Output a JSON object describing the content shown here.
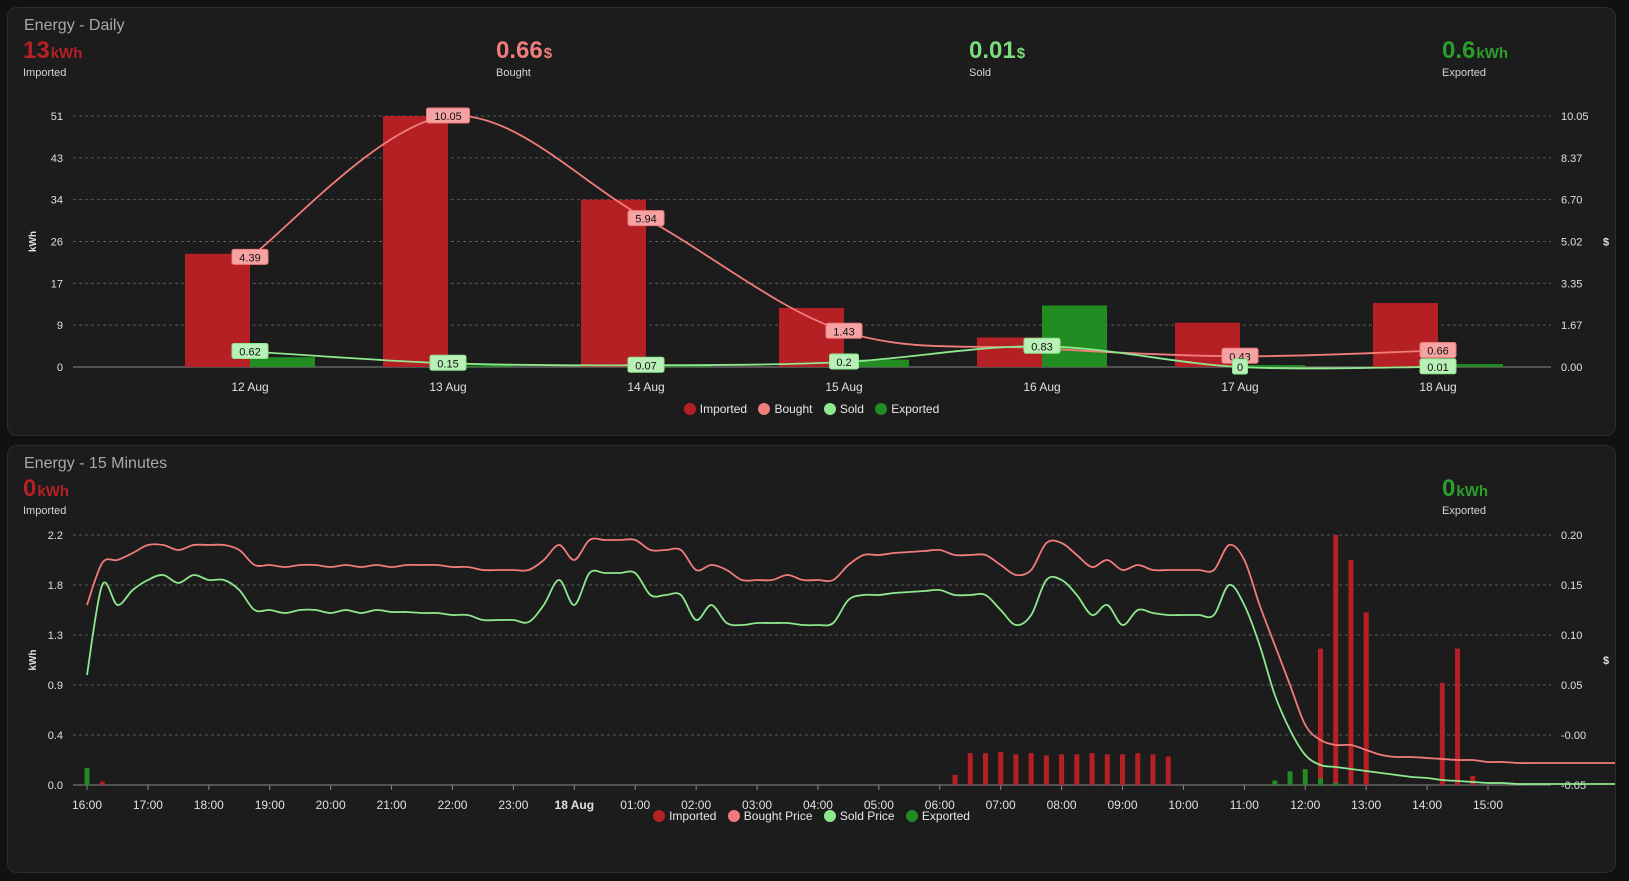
{
  "colors": {
    "imported": "#b52025",
    "bought": "#f07c7c",
    "sold": "#8ee88e",
    "exported": "#228b22",
    "sold_stat": "#7bdc7b",
    "exported_stat": "#2aa02a"
  },
  "daily": {
    "title": "Energy - Daily",
    "stats": [
      {
        "value": "13",
        "unit": "kWh",
        "label": "Imported"
      },
      {
        "value": "0.66",
        "unit": "$",
        "label": "Bought"
      },
      {
        "value": "0.01",
        "unit": "$",
        "label": "Sold"
      },
      {
        "value": "0.6",
        "unit": "kWh",
        "label": "Exported"
      }
    ],
    "legend": [
      "Imported",
      "Bought",
      "Sold",
      "Exported"
    ]
  },
  "quarter": {
    "title": "Energy - 15 Minutes",
    "stats": [
      {
        "value": "0",
        "unit": "kWh",
        "label": "Imported"
      },
      {
        "value": "0",
        "unit": "kWh",
        "label": "Exported"
      }
    ],
    "legend": [
      "Imported",
      "Bought Price",
      "Sold Price",
      "Exported"
    ]
  },
  "chart_data": [
    {
      "type": "bar",
      "title": "Energy - Daily",
      "categories": [
        "12 Aug",
        "13 Aug",
        "14 Aug",
        "15 Aug",
        "16 Aug",
        "17 Aug",
        "18 Aug"
      ],
      "ylabel": "kWh",
      "y2label": "$",
      "ylim": [
        0,
        51
      ],
      "y2lim": [
        0,
        10.05
      ],
      "yticks": [
        "0",
        "9",
        "17",
        "26",
        "34",
        "43",
        "51"
      ],
      "y2ticks": [
        "0.00",
        "1.67",
        "3.35",
        "5.02",
        "6.70",
        "8.37",
        "10.05"
      ],
      "grid": true,
      "legend_position": "bottom",
      "series": [
        {
          "name": "Imported",
          "kind": "bar",
          "axis": "kWh",
          "values": [
            23,
            51,
            34,
            12,
            6,
            9,
            13
          ]
        },
        {
          "name": "Exported",
          "kind": "bar",
          "axis": "kWh",
          "values": [
            2,
            0.3,
            0.3,
            1.5,
            12.5,
            0.4,
            0.6
          ]
        },
        {
          "name": "Bought",
          "kind": "line",
          "axis": "$",
          "values": [
            4.39,
            10.05,
            5.94,
            1.43,
            0.75,
            0.43,
            0.66
          ],
          "labels": [
            "4.39",
            "10.05",
            "5.94",
            "1.43",
            "",
            "0.43",
            "0.66"
          ]
        },
        {
          "name": "Sold",
          "kind": "line",
          "axis": "$",
          "values": [
            0.62,
            0.15,
            0.07,
            0.2,
            0.83,
            0,
            0.01
          ],
          "labels": [
            "0.62",
            "0.15",
            "0.07",
            "0.2",
            "0.83",
            "0",
            "0.01"
          ]
        }
      ]
    },
    {
      "type": "bar",
      "title": "Energy - 15 Minutes",
      "ylabel": "kWh",
      "y2label": "$",
      "ylim": [
        0,
        2.2
      ],
      "y2lim": [
        -0.05,
        0.2
      ],
      "yticks": [
        "0.0",
        "0.4",
        "0.9",
        "1.3",
        "1.8",
        "2.2"
      ],
      "y2ticks": [
        "-0.05",
        "-0.00",
        "0.05",
        "0.10",
        "0.15",
        "0.20"
      ],
      "x_start": "16:00",
      "x_step_minutes": 15,
      "xticks": [
        "16:00",
        "17:00",
        "18:00",
        "19:00",
        "20:00",
        "21:00",
        "22:00",
        "23:00",
        "18 Aug",
        "01:00",
        "02:00",
        "03:00",
        "04:00",
        "05:00",
        "06:00",
        "07:00",
        "08:00",
        "09:00",
        "10:00",
        "11:00",
        "12:00",
        "13:00",
        "14:00",
        "15:00"
      ],
      "grid": true,
      "legend_position": "bottom",
      "series": [
        {
          "name": "Bought Price",
          "kind": "line",
          "axis": "$",
          "values": [
            0.13,
            0.172,
            0.175,
            0.182,
            0.19,
            0.19,
            0.185,
            0.19,
            0.19,
            0.19,
            0.185,
            0.17,
            0.17,
            0.168,
            0.17,
            0.17,
            0.168,
            0.17,
            0.168,
            0.17,
            0.168,
            0.17,
            0.17,
            0.17,
            0.168,
            0.168,
            0.165,
            0.165,
            0.165,
            0.165,
            0.175,
            0.19,
            0.175,
            0.195,
            0.195,
            0.195,
            0.195,
            0.185,
            0.185,
            0.185,
            0.165,
            0.17,
            0.165,
            0.155,
            0.155,
            0.155,
            0.16,
            0.155,
            0.155,
            0.155,
            0.17,
            0.18,
            0.18,
            0.182,
            0.183,
            0.184,
            0.185,
            0.18,
            0.18,
            0.18,
            0.17,
            0.16,
            0.165,
            0.192,
            0.192,
            0.18,
            0.168,
            0.175,
            0.165,
            0.17,
            0.165,
            0.165,
            0.165,
            0.165,
            0.165,
            0.19,
            0.175,
            0.13,
            0.09,
            0.05,
            0.01,
            -0.005,
            -0.01,
            -0.01,
            -0.015,
            -0.02,
            -0.022,
            -0.022,
            -0.023,
            -0.024,
            -0.025,
            -0.025,
            -0.027,
            -0.027,
            -0.028,
            -0.028,
            -0.028,
            -0.028,
            -0.028,
            -0.028,
            -0.028,
            -0.028,
            -0.028,
            -0.028,
            -0.028,
            -0.028,
            -0.028,
            -0.027,
            -0.026,
            -0.025,
            -0.024,
            -0.024,
            -0.024,
            -0.023,
            -0.022,
            -0.02,
            -0.018,
            -0.015
          ]
        },
        {
          "name": "Sold Price",
          "kind": "line",
          "axis": "$",
          "values": [
            0.06,
            0.15,
            0.13,
            0.145,
            0.155,
            0.16,
            0.152,
            0.16,
            0.155,
            0.155,
            0.145,
            0.125,
            0.125,
            0.122,
            0.125,
            0.125,
            0.122,
            0.125,
            0.122,
            0.125,
            0.123,
            0.123,
            0.122,
            0.122,
            0.12,
            0.12,
            0.115,
            0.115,
            0.115,
            0.113,
            0.13,
            0.155,
            0.13,
            0.162,
            0.162,
            0.162,
            0.162,
            0.14,
            0.14,
            0.14,
            0.115,
            0.13,
            0.112,
            0.11,
            0.112,
            0.112,
            0.112,
            0.11,
            0.11,
            0.112,
            0.135,
            0.14,
            0.14,
            0.142,
            0.143,
            0.144,
            0.145,
            0.14,
            0.14,
            0.14,
            0.125,
            0.11,
            0.12,
            0.155,
            0.155,
            0.14,
            0.12,
            0.13,
            0.11,
            0.125,
            0.122,
            0.12,
            0.12,
            0.12,
            0.12,
            0.15,
            0.13,
            0.09,
            0.04,
            0.005,
            -0.02,
            -0.03,
            -0.032,
            -0.034,
            -0.036,
            -0.038,
            -0.04,
            -0.042,
            -0.043,
            -0.045,
            -0.046,
            -0.047,
            -0.048,
            -0.048,
            -0.049,
            -0.049,
            -0.049,
            -0.049,
            -0.049,
            -0.049,
            -0.049,
            -0.049,
            -0.049,
            -0.049,
            -0.049,
            -0.049,
            -0.049,
            -0.049,
            -0.049,
            -0.048,
            -0.048,
            -0.047,
            -0.046,
            -0.045,
            -0.044,
            -0.042,
            -0.04,
            -0.038
          ]
        },
        {
          "name": "Imported",
          "kind": "bar",
          "axis": "kWh",
          "values": [
            0,
            0.03,
            0,
            0,
            0,
            0,
            0,
            0,
            0,
            0,
            0,
            0,
            0,
            0,
            0,
            0,
            0,
            0,
            0,
            0,
            0,
            0,
            0,
            0,
            0,
            0,
            0,
            0,
            0,
            0,
            0,
            0,
            0,
            0,
            0,
            0,
            0,
            0,
            0,
            0,
            0,
            0,
            0,
            0,
            0,
            0,
            0,
            0,
            0,
            0,
            0,
            0,
            0,
            0,
            0,
            0,
            0,
            0.09,
            0.28,
            0.28,
            0.29,
            0.27,
            0.28,
            0.26,
            0.27,
            0.27,
            0.28,
            0.27,
            0.27,
            0.28,
            0.27,
            0.25,
            0,
            0,
            0,
            0,
            0,
            0,
            0,
            0,
            0,
            1.2,
            2.2,
            1.98,
            1.52,
            0,
            0,
            0,
            0,
            0.9,
            1.2,
            0.08,
            0,
            0,
            0,
            0,
            0,
            0,
            0,
            0,
            0,
            0,
            0,
            0,
            0,
            0,
            0,
            0,
            0,
            0,
            0,
            0,
            0,
            0,
            0,
            0
          ]
        },
        {
          "name": "Exported",
          "kind": "bar",
          "axis": "kWh",
          "values": [
            0.15,
            0,
            0,
            0,
            0,
            0,
            0,
            0,
            0,
            0,
            0,
            0,
            0,
            0,
            0,
            0,
            0,
            0,
            0,
            0,
            0,
            0,
            0,
            0,
            0,
            0,
            0,
            0,
            0,
            0,
            0,
            0,
            0,
            0,
            0,
            0,
            0,
            0,
            0,
            0,
            0,
            0,
            0,
            0,
            0,
            0,
            0,
            0,
            0,
            0,
            0,
            0,
            0,
            0,
            0,
            0,
            0,
            0,
            0,
            0,
            0,
            0,
            0,
            0,
            0,
            0,
            0,
            0,
            0,
            0,
            0,
            0,
            0,
            0,
            0,
            0,
            0,
            0,
            0.04,
            0.12,
            0.14,
            0.06,
            0.02,
            0,
            0,
            0,
            0,
            0,
            0,
            0,
            0,
            0,
            0,
            0,
            0,
            0,
            0,
            0,
            0,
            0,
            0,
            0,
            0,
            0,
            0,
            0,
            0,
            0,
            0,
            0,
            0,
            0,
            0,
            0,
            0,
            0,
            0,
            0
          ]
        }
      ]
    }
  ]
}
